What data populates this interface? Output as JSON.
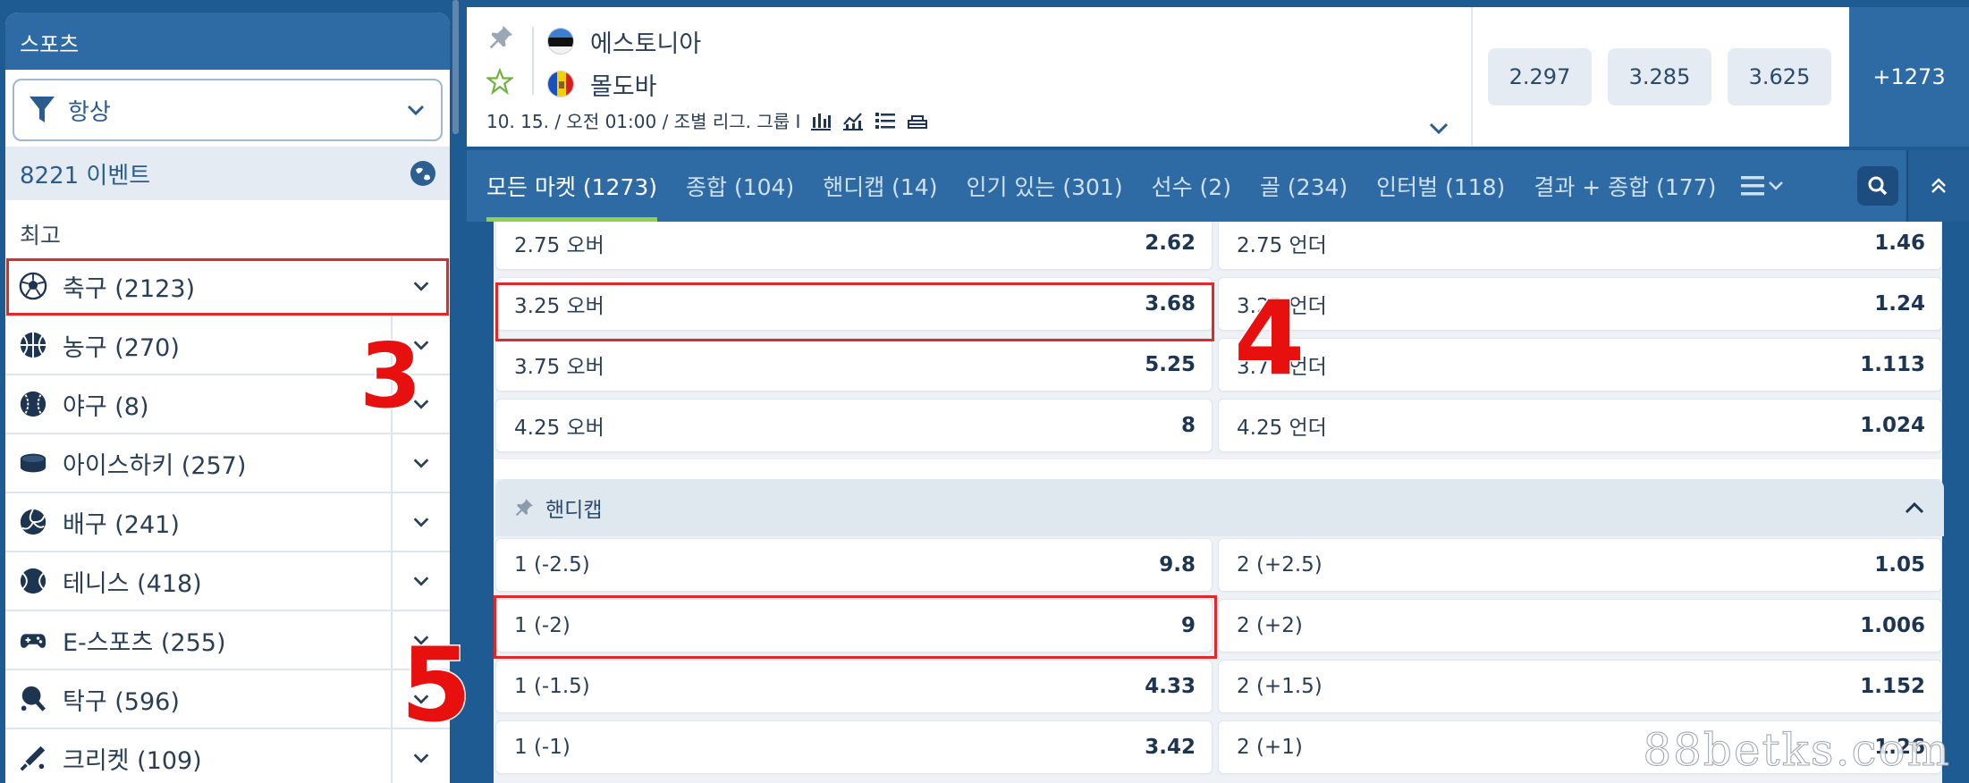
{
  "sidebar": {
    "header": "스포츠",
    "filter_label": "항상",
    "events_label": "8221 이벤트",
    "section_label": "최고",
    "sports": [
      {
        "label": "축구 (2123)",
        "icon": "soccer-ball-icon"
      },
      {
        "label": "농구 (270)",
        "icon": "basketball-icon"
      },
      {
        "label": "야구 (8)",
        "icon": "baseball-icon"
      },
      {
        "label": "아이스하키 (257)",
        "icon": "hockey-puck-icon"
      },
      {
        "label": "배구 (241)",
        "icon": "volleyball-icon"
      },
      {
        "label": "테니스 (418)",
        "icon": "tennis-ball-icon"
      },
      {
        "label": "E-스포츠 (255)",
        "icon": "gamepad-icon"
      },
      {
        "label": "탁구 (596)",
        "icon": "ping-pong-icon"
      },
      {
        "label": "크리켓 (109)",
        "icon": "cricket-bat-icon"
      }
    ]
  },
  "match": {
    "home_team": "에스토니아",
    "away_team": "몰도바",
    "meta": "10. 15. / 오전 01:00 / 조별 리그. 그룹 I",
    "odds": [
      "2.297",
      "3.285",
      "3.625"
    ],
    "more": "+1273"
  },
  "tabs": [
    {
      "label": "모든 마켓 (1273)",
      "active": true
    },
    {
      "label": "종합 (104)"
    },
    {
      "label": "핸디캡 (14)"
    },
    {
      "label": "인기 있는 (301)"
    },
    {
      "label": "선수 (2)"
    },
    {
      "label": "골 (234)"
    },
    {
      "label": "인터벌 (118)"
    },
    {
      "label": "결과 + 종합 (177)"
    }
  ],
  "totals": [
    {
      "left_label": "2.75 오버",
      "left_value": "2.62",
      "right_label": "2.75 언더",
      "right_value": "1.46"
    },
    {
      "left_label": "3.25 오버",
      "left_value": "3.68",
      "right_label": "3.25 언더",
      "right_value": "1.24"
    },
    {
      "left_label": "3.75 오버",
      "left_value": "5.25",
      "right_label": "3.75 언더",
      "right_value": "1.113"
    },
    {
      "left_label": "4.25 오버",
      "left_value": "8",
      "right_label": "4.25 언더",
      "right_value": "1.024"
    }
  ],
  "handicap": {
    "title": "핸디캡",
    "rows": [
      {
        "left_label": "1 (-2.5)",
        "left_value": "9.8",
        "right_label": "2 (+2.5)",
        "right_value": "1.05"
      },
      {
        "left_label": "1 (-2)",
        "left_value": "9",
        "right_label": "2 (+2)",
        "right_value": "1.006"
      },
      {
        "left_label": "1 (-1.5)",
        "left_value": "4.33",
        "right_label": "2 (+1.5)",
        "right_value": "1.152"
      },
      {
        "left_label": "1 (-1)",
        "left_value": "3.42",
        "right_label": "2 (+1)",
        "right_value": "1.26"
      }
    ]
  },
  "annotations": {
    "step3": "3",
    "step4": "4",
    "step5": "5"
  },
  "watermark": "88betks.com",
  "colors": {
    "accent": "#2e6ba5",
    "highlight": "#e02a2a",
    "active_tab_underline": "#8fd14f"
  }
}
